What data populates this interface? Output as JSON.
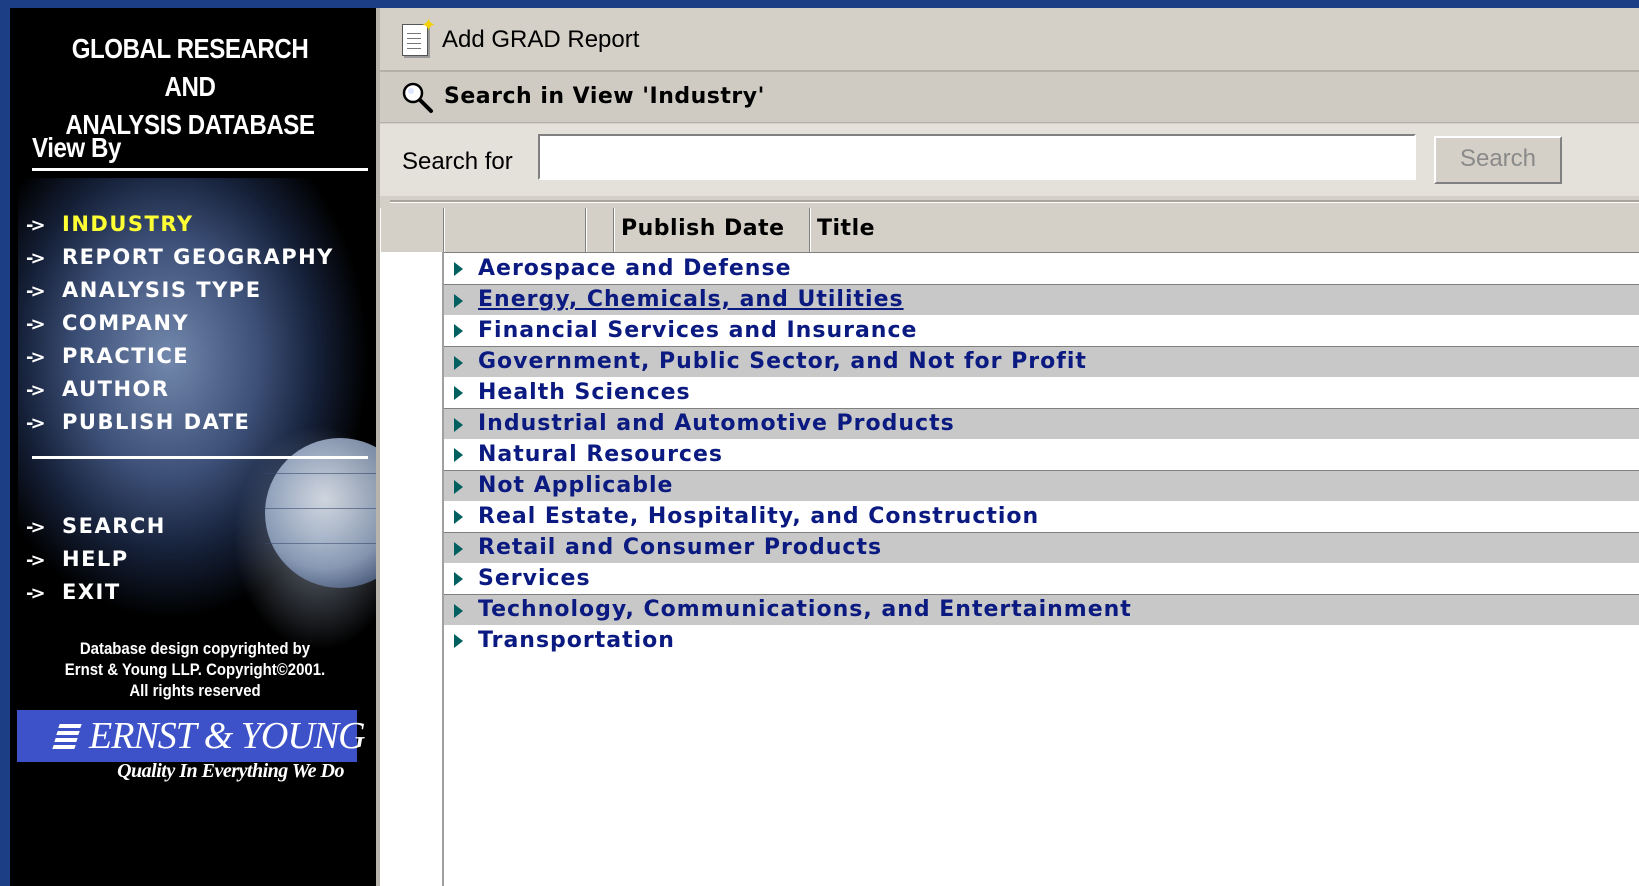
{
  "sidebar": {
    "title_line1": "GLOBAL RESEARCH AND",
    "title_line2": "ANALYSIS DATABASE",
    "view_by_heading": "View By",
    "view_items": [
      {
        "label": "INDUSTRY",
        "active": true
      },
      {
        "label": "REPORT GEOGRAPHY",
        "active": false
      },
      {
        "label": "ANALYSIS TYPE",
        "active": false
      },
      {
        "label": "COMPANY",
        "active": false
      },
      {
        "label": "PRACTICE",
        "active": false
      },
      {
        "label": "AUTHOR",
        "active": false
      },
      {
        "label": "PUBLISH DATE",
        "active": false
      }
    ],
    "utility_items": [
      {
        "label": "SEARCH"
      },
      {
        "label": "HELP"
      },
      {
        "label": "EXIT"
      }
    ],
    "nav_arrow": "->",
    "copyright_line1": "Database design copyrighted by",
    "copyright_line2": "Ernst & Young LLP. Copyright©2001.",
    "copyright_line3": "All rights reserved",
    "logo_text": "ERNST & YOUNG",
    "tagline": "Quality In Everything We Do",
    "colors": {
      "active_item": "#ffff33",
      "logo_bg": "#3d52c8",
      "background": "#000000"
    }
  },
  "toolbar": {
    "add_report_label": "Add GRAD Report",
    "add_report_icon": "new-document-icon"
  },
  "search": {
    "title": "Search in View 'Industry'",
    "search_icon": "magnifier-icon",
    "label": "Search for",
    "input_value": "",
    "button_label": "Search"
  },
  "view": {
    "columns": [
      "",
      "",
      "Publish Date",
      "Title"
    ],
    "rows": [
      "Aerospace and Defense",
      "Energy, Chemicals, and Utilities",
      "Financial Services and Insurance",
      "Government, Public Sector, and Not for Profit",
      "Health Sciences",
      "Industrial and Automotive Products",
      "Natural Resources",
      "Not Applicable",
      "Real Estate, Hospitality, and Construction",
      "Retail and Consumer Products",
      "Services",
      "Technology, Communications, and Entertainment",
      "Transportation"
    ],
    "twistie_icon": "expand-triangle-icon",
    "colors": {
      "category_text": "#0a1a80",
      "alt_row": "#c8c8c8",
      "twistie": "#006060"
    }
  }
}
